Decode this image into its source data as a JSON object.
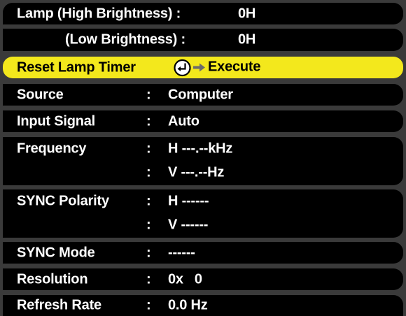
{
  "menu": {
    "lamp_high_label": "Lamp (High Brightness) :",
    "lamp_high_value": "0H",
    "lamp_low_label": "(Low Brightness)  :",
    "lamp_low_value": "0H",
    "reset_label": "Reset Lamp Timer",
    "reset_action": "Execute",
    "rows": [
      {
        "label": "Source",
        "colon": ":",
        "value": "Computer"
      },
      {
        "label": "Input Signal",
        "colon": ":",
        "value": "Auto"
      },
      {
        "label": "Frequency",
        "colon": ":",
        "value": "H ---.--kHz"
      },
      {
        "label": "",
        "colon": ":",
        "value": "V ---.--Hz"
      },
      {
        "label": "SYNC Polarity",
        "colon": ":",
        "value": "H ------"
      },
      {
        "label": "",
        "colon": ":",
        "value": "V ------"
      },
      {
        "label": "SYNC Mode",
        "colon": ":",
        "value": "------"
      },
      {
        "label": "Resolution",
        "colon": ":",
        "value": "0x   0"
      },
      {
        "label": "Refresh Rate",
        "colon": ":",
        "value": "0.0 Hz"
      }
    ]
  },
  "colors": {
    "highlight": "#f3e81c",
    "row_bg": "#000000",
    "gap": "#3a3a3a"
  },
  "icons": {
    "enter": "enter-icon",
    "arrow": "arrow-right-icon"
  }
}
